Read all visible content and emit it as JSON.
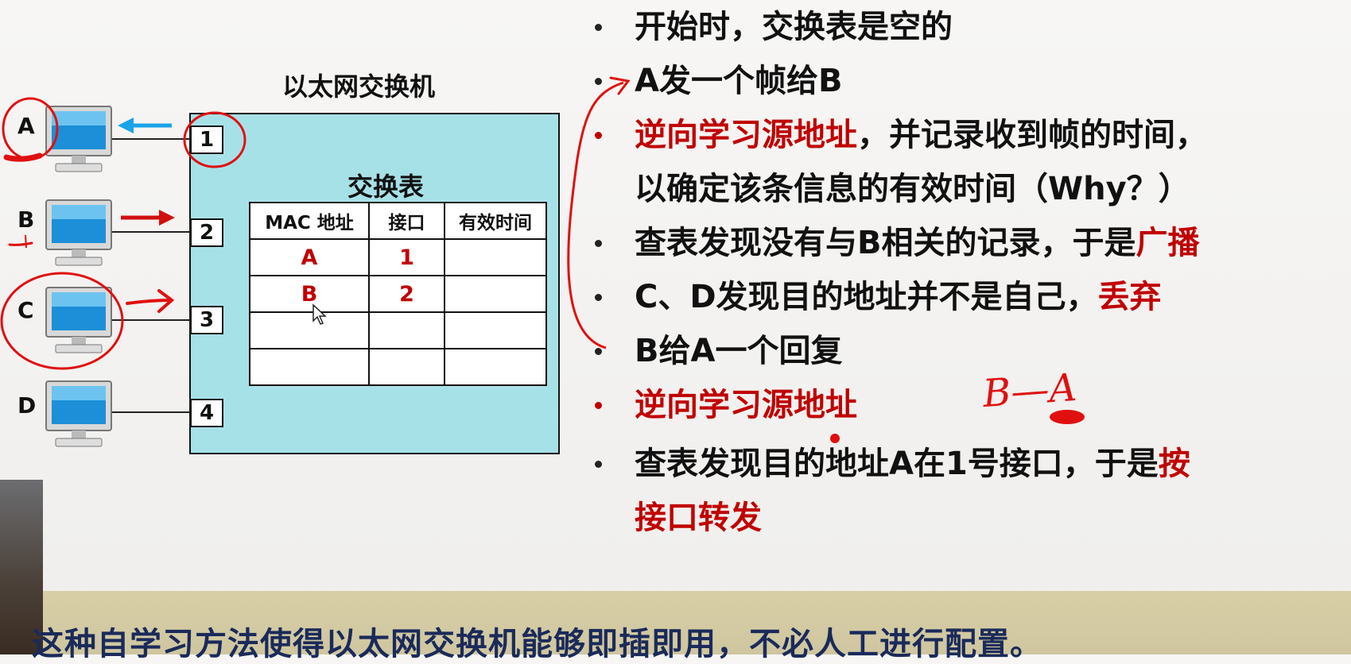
{
  "switch": {
    "title": "以太网交换机",
    "table_title": "交换表",
    "ports": [
      "1",
      "2",
      "3",
      "4"
    ],
    "headers": [
      "MAC 地址",
      "接口",
      "有效时间"
    ],
    "rows": [
      [
        "A",
        "1",
        ""
      ],
      [
        "B",
        "2",
        ""
      ],
      [
        "",
        "",
        ""
      ],
      [
        "",
        "",
        ""
      ]
    ]
  },
  "computers": [
    "A",
    "B",
    "C",
    "D"
  ],
  "bullets": [
    {
      "parts": [
        {
          "t": "开始时，交换表是空的",
          "red": false
        }
      ],
      "dot": "black"
    },
    {
      "parts": [
        {
          "t": "A发一个帧给B",
          "red": false
        }
      ],
      "dot": "black"
    },
    {
      "parts": [
        {
          "t": "逆向学习源地址",
          "red": true
        },
        {
          "t": "，并记录收到帧的时间，",
          "red": false
        }
      ],
      "dot": "red"
    },
    {
      "parts": [
        {
          "t": "以确定该条信息的有效时间（Why？）",
          "red": false
        }
      ],
      "dot": "none"
    },
    {
      "parts": [
        {
          "t": "查表发现没有与B相关的记录，于是",
          "red": false
        },
        {
          "t": "广播",
          "red": true
        }
      ],
      "dot": "black"
    },
    {
      "parts": [
        {
          "t": "C、D发现目的地址并不是自己，",
          "red": false
        },
        {
          "t": "丢弃",
          "red": true
        }
      ],
      "dot": "black"
    },
    {
      "parts": [
        {
          "t": "B给A一个回复",
          "red": false
        }
      ],
      "dot": "black"
    },
    {
      "parts": [
        {
          "t": "逆向学习源地址",
          "red": true
        }
      ],
      "dot": "red"
    },
    {
      "parts": [
        {
          "t": "查表发现目的地址A在1号接口，于是",
          "red": false
        },
        {
          "t": "按",
          "red": true
        }
      ],
      "dot": "black"
    },
    {
      "parts": [
        {
          "t": "接口转发",
          "red": true
        }
      ],
      "dot": "none"
    }
  ],
  "annotation": "B—A",
  "subtitle": "这种自学习方法使得以太网交换机能够即插即用，不必人工进行配置。",
  "colors": {
    "switch_fill": "#a7e1e8",
    "accent_red": "#c00000",
    "arrow_blue": "#1aa3e8"
  }
}
